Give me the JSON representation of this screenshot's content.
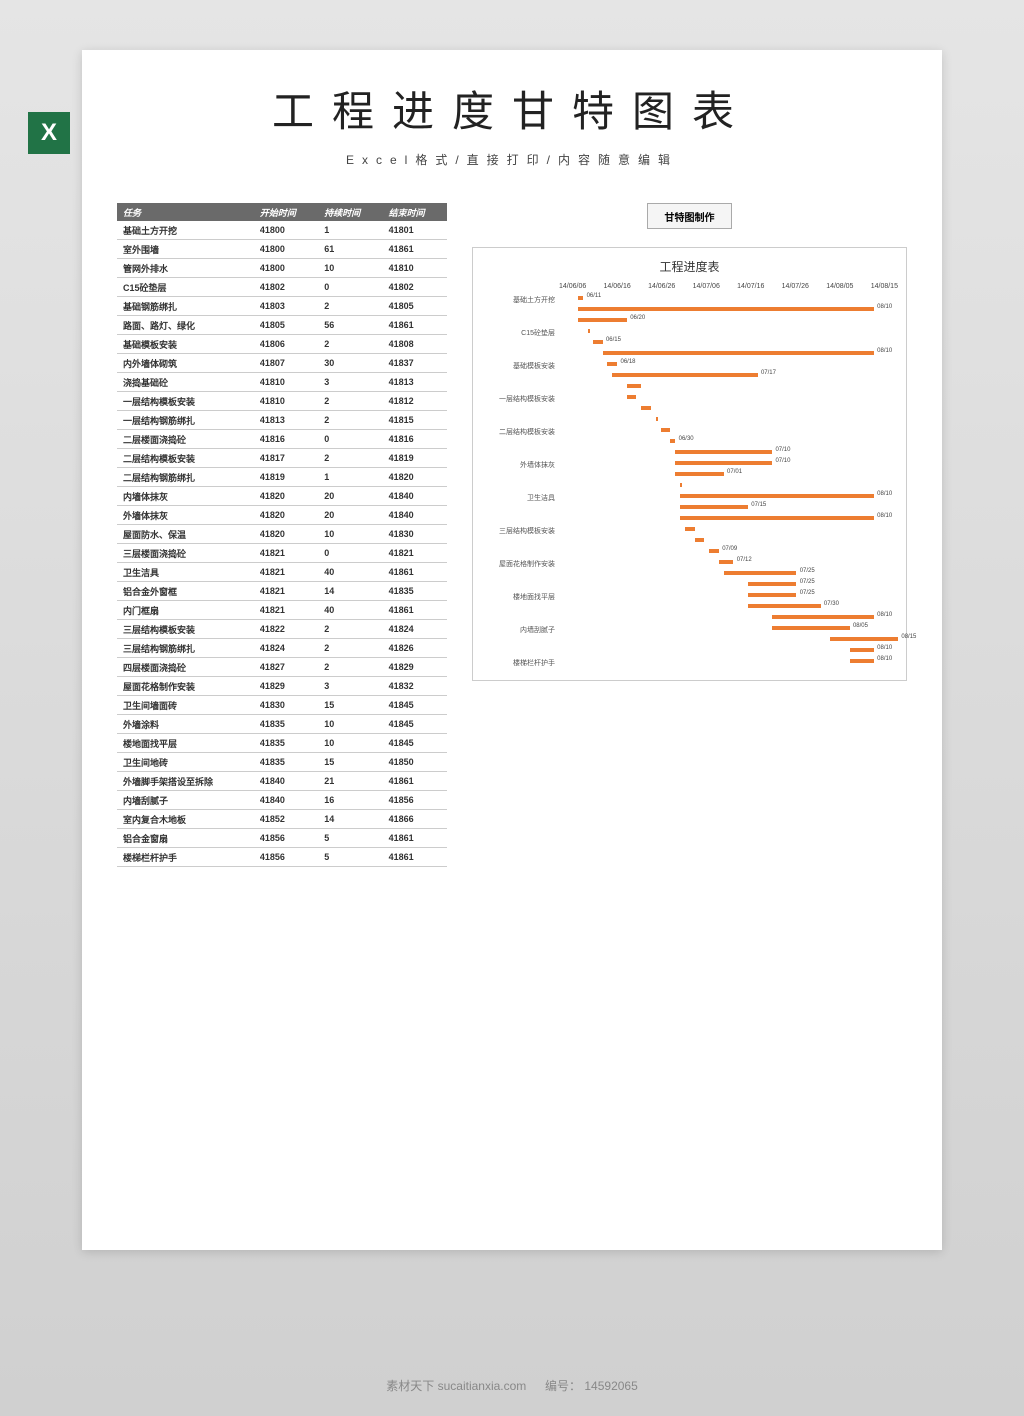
{
  "title": "工程进度甘特图表",
  "subtitle": "Excel格式/直接打印/内容随意编辑",
  "excel_icon_text": "X",
  "gantt_button": "甘特图制作",
  "table_headers": {
    "task": "任务",
    "start": "开始时间",
    "duration": "持续时间",
    "end": "结束时间"
  },
  "table_rows": [
    {
      "task": "基础土方开挖",
      "start": "41800",
      "dur": "1",
      "end": "41801"
    },
    {
      "task": "室外围墙",
      "start": "41800",
      "dur": "61",
      "end": "41861"
    },
    {
      "task": "管网外排水",
      "start": "41800",
      "dur": "10",
      "end": "41810"
    },
    {
      "task": "C15砼垫层",
      "start": "41802",
      "dur": "0",
      "end": "41802"
    },
    {
      "task": "基础钢筋绑扎",
      "start": "41803",
      "dur": "2",
      "end": "41805"
    },
    {
      "task": "路面、路灯、绿化",
      "start": "41805",
      "dur": "56",
      "end": "41861"
    },
    {
      "task": "基础模板安装",
      "start": "41806",
      "dur": "2",
      "end": "41808"
    },
    {
      "task": "内外墙体砌筑",
      "start": "41807",
      "dur": "30",
      "end": "41837"
    },
    {
      "task": "浇捣基础砼",
      "start": "41810",
      "dur": "3",
      "end": "41813"
    },
    {
      "task": "一层结构模板安装",
      "start": "41810",
      "dur": "2",
      "end": "41812"
    },
    {
      "task": "一层结构钢筋绑扎",
      "start": "41813",
      "dur": "2",
      "end": "41815"
    },
    {
      "task": "二层楼面浇捣砼",
      "start": "41816",
      "dur": "0",
      "end": "41816"
    },
    {
      "task": "二层结构模板安装",
      "start": "41817",
      "dur": "2",
      "end": "41819"
    },
    {
      "task": "二层结构钢筋绑扎",
      "start": "41819",
      "dur": "1",
      "end": "41820"
    },
    {
      "task": "内墙体抹灰",
      "start": "41820",
      "dur": "20",
      "end": "41840"
    },
    {
      "task": "外墙体抹灰",
      "start": "41820",
      "dur": "20",
      "end": "41840"
    },
    {
      "task": "屋面防水、保温",
      "start": "41820",
      "dur": "10",
      "end": "41830"
    },
    {
      "task": "三层楼面浇捣砼",
      "start": "41821",
      "dur": "0",
      "end": "41821"
    },
    {
      "task": "卫生洁具",
      "start": "41821",
      "dur": "40",
      "end": "41861"
    },
    {
      "task": "铝合金外窗框",
      "start": "41821",
      "dur": "14",
      "end": "41835"
    },
    {
      "task": "内门框扇",
      "start": "41821",
      "dur": "40",
      "end": "41861"
    },
    {
      "task": "三层结构模板安装",
      "start": "41822",
      "dur": "2",
      "end": "41824"
    },
    {
      "task": "三层结构钢筋绑扎",
      "start": "41824",
      "dur": "2",
      "end": "41826"
    },
    {
      "task": "四层楼面浇捣砼",
      "start": "41827",
      "dur": "2",
      "end": "41829"
    },
    {
      "task": "屋面花格制作安装",
      "start": "41829",
      "dur": "3",
      "end": "41832"
    },
    {
      "task": "卫生间墙面砖",
      "start": "41830",
      "dur": "15",
      "end": "41845"
    },
    {
      "task": "外墙涂料",
      "start": "41835",
      "dur": "10",
      "end": "41845"
    },
    {
      "task": "楼地面找平层",
      "start": "41835",
      "dur": "10",
      "end": "41845"
    },
    {
      "task": "卫生间地砖",
      "start": "41835",
      "dur": "15",
      "end": "41850"
    },
    {
      "task": "外墙脚手架搭设至拆除",
      "start": "41840",
      "dur": "21",
      "end": "41861"
    },
    {
      "task": "内墙刮腻子",
      "start": "41840",
      "dur": "16",
      "end": "41856"
    },
    {
      "task": "室内复合木地板",
      "start": "41852",
      "dur": "14",
      "end": "41866"
    },
    {
      "task": "铝合金窗扇",
      "start": "41856",
      "dur": "5",
      "end": "41861"
    },
    {
      "task": "楼梯栏杆护手",
      "start": "41856",
      "dur": "5",
      "end": "41861"
    }
  ],
  "chart_data": {
    "type": "bar",
    "title": "工程进度表",
    "xaxis_labels": [
      "14/06/06",
      "14/06/16",
      "14/06/26",
      "14/07/06",
      "14/07/16",
      "14/07/26",
      "14/08/05",
      "14/08/15"
    ],
    "xlabel": "",
    "ylabel": "",
    "x_range": [
      41796,
      41866
    ],
    "series": [
      {
        "name": "开始时间",
        "role": "offset"
      },
      {
        "name": "持续时间",
        "role": "duration"
      }
    ],
    "y_categories_shown": [
      "基础土方开挖",
      "C15砼垫层",
      "基础模板安装",
      "一层结构模板安装",
      "二层结构模板安装",
      "外墙体抹灰",
      "卫生洁具",
      "三层结构模板安装",
      "屋面花格制作安装",
      "楼地面找平层",
      "内墙刮腻子",
      "楼梯栏杆护手"
    ],
    "tasks": [
      {
        "task": "基础土方开挖",
        "start": 41800,
        "dur": 1,
        "end_label": "06/11"
      },
      {
        "task": "室外围墙",
        "start": 41800,
        "dur": 61,
        "end_label": "08/10"
      },
      {
        "task": "管网外排水",
        "start": 41800,
        "dur": 10,
        "end_label": "06/20"
      },
      {
        "task": "C15砼垫层",
        "start": 41802,
        "dur": 0,
        "end_label": ""
      },
      {
        "task": "基础钢筋绑扎",
        "start": 41803,
        "dur": 2,
        "end_label": "06/15"
      },
      {
        "task": "路面、路灯、绿化",
        "start": 41805,
        "dur": 56,
        "end_label": "08/10"
      },
      {
        "task": "基础模板安装",
        "start": 41806,
        "dur": 2,
        "end_label": "06/18"
      },
      {
        "task": "内外墙体砌筑",
        "start": 41807,
        "dur": 30,
        "end_label": "07/17"
      },
      {
        "task": "浇捣基础砼",
        "start": 41810,
        "dur": 3,
        "end_label": ""
      },
      {
        "task": "一层结构模板安装",
        "start": 41810,
        "dur": 2,
        "end_label": ""
      },
      {
        "task": "一层结构钢筋绑扎",
        "start": 41813,
        "dur": 2,
        "end_label": ""
      },
      {
        "task": "二层楼面浇捣砼",
        "start": 41816,
        "dur": 0,
        "end_label": ""
      },
      {
        "task": "二层结构模板安装",
        "start": 41817,
        "dur": 2,
        "end_label": ""
      },
      {
        "task": "二层结构钢筋绑扎",
        "start": 41819,
        "dur": 1,
        "end_label": "06/30"
      },
      {
        "task": "内墙体抹灰",
        "start": 41820,
        "dur": 20,
        "end_label": "07/10"
      },
      {
        "task": "外墙体抹灰",
        "start": 41820,
        "dur": 20,
        "end_label": "07/10"
      },
      {
        "task": "屋面防水、保温",
        "start": 41820,
        "dur": 10,
        "end_label": "07/01"
      },
      {
        "task": "三层楼面浇捣砼",
        "start": 41821,
        "dur": 0,
        "end_label": ""
      },
      {
        "task": "卫生洁具",
        "start": 41821,
        "dur": 40,
        "end_label": "08/10"
      },
      {
        "task": "铝合金外窗框",
        "start": 41821,
        "dur": 14,
        "end_label": "07/15"
      },
      {
        "task": "内门框扇",
        "start": 41821,
        "dur": 40,
        "end_label": "08/10"
      },
      {
        "task": "三层结构模板安装",
        "start": 41822,
        "dur": 2,
        "end_label": ""
      },
      {
        "task": "三层结构钢筋绑扎",
        "start": 41824,
        "dur": 2,
        "end_label": ""
      },
      {
        "task": "四层楼面浇捣砼",
        "start": 41827,
        "dur": 2,
        "end_label": "07/09"
      },
      {
        "task": "屋面花格制作安装",
        "start": 41829,
        "dur": 3,
        "end_label": "07/12"
      },
      {
        "task": "卫生间墙面砖",
        "start": 41830,
        "dur": 15,
        "end_label": "07/25"
      },
      {
        "task": "外墙涂料",
        "start": 41835,
        "dur": 10,
        "end_label": "07/25"
      },
      {
        "task": "楼地面找平层",
        "start": 41835,
        "dur": 10,
        "end_label": "07/25"
      },
      {
        "task": "卫生间地砖",
        "start": 41835,
        "dur": 15,
        "end_label": "07/30"
      },
      {
        "task": "外墙脚手架搭设至拆除",
        "start": 41840,
        "dur": 21,
        "end_label": "08/10"
      },
      {
        "task": "内墙刮腻子",
        "start": 41840,
        "dur": 16,
        "end_label": "08/05"
      },
      {
        "task": "室内复合木地板",
        "start": 41852,
        "dur": 14,
        "end_label": "08/15"
      },
      {
        "task": "铝合金窗扇",
        "start": 41856,
        "dur": 5,
        "end_label": "08/10"
      },
      {
        "task": "楼梯栏杆护手",
        "start": 41856,
        "dur": 5,
        "end_label": "08/10"
      }
    ]
  },
  "footer": {
    "site_label": "素材天下",
    "url": "sucaitianxia.com",
    "id_label": "编号：",
    "id_value": "14592065"
  }
}
